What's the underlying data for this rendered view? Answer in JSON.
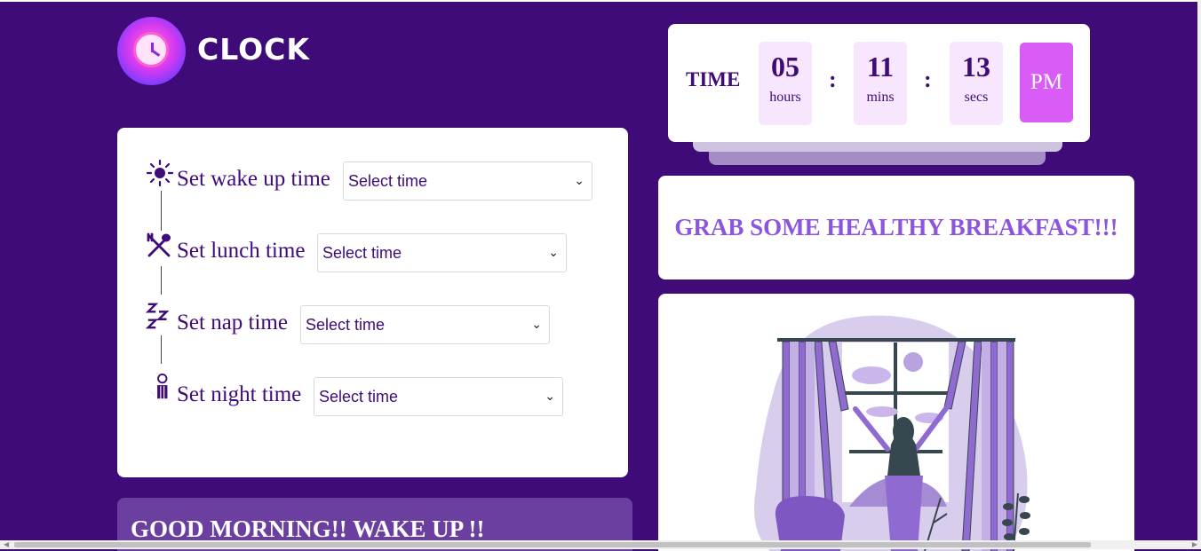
{
  "logo": {
    "text": "CLOCK",
    "icon": "alarm-clock-icon"
  },
  "clock": {
    "label": "TIME",
    "hours": "05",
    "hours_unit": "hours",
    "mins": "11",
    "mins_unit": "mins",
    "secs": "13",
    "secs_unit": "secs",
    "separator": ":",
    "ampm": "PM"
  },
  "schedule": {
    "rows": [
      {
        "label": "Set wake up time",
        "icon": "sun-icon",
        "select_value": "Select time"
      },
      {
        "label": "Set lunch time",
        "icon": "fork-spoon-icon",
        "select_value": "Select time"
      },
      {
        "label": "Set nap time",
        "icon": "zzz-icon",
        "select_value": "Select time"
      },
      {
        "label": "Set night time",
        "icon": "moon-night-icon",
        "select_value": "Select time"
      }
    ]
  },
  "greeting": "GOOD MORNING!! WAKE UP !!",
  "message": "GRAB SOME HEALTHY BREAKFAST!!!",
  "illustration": {
    "name": "woman-opening-curtains-illustration"
  },
  "colors": {
    "background": "#3e0b78",
    "accent": "#d85cf5",
    "message": "#8b55e0",
    "greeting_bg": "#6b3fa0"
  }
}
